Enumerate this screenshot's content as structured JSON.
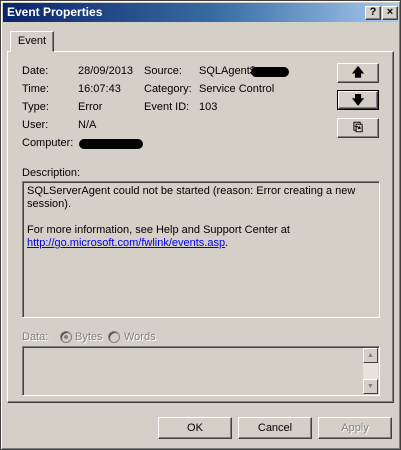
{
  "window": {
    "title": "Event Properties",
    "help_glyph": "?",
    "close_glyph": "×"
  },
  "tabs": [
    {
      "label": "Event"
    }
  ],
  "event": {
    "date_label": "Date:",
    "date_value": "28/09/2013",
    "source_label": "Source:",
    "source_value": "SQLAgent$",
    "time_label": "Time:",
    "time_value": "16:07:43",
    "category_label": "Category:",
    "category_value": "Service Control",
    "type_label": "Type:",
    "type_value": "Error",
    "eventid_label": "Event ID:",
    "eventid_value": "103",
    "user_label": "User:",
    "user_value": "N/A",
    "computer_label": "Computer:"
  },
  "nav": {
    "up_glyph": "🡅",
    "down_glyph": "🡇",
    "copy_glyph": "⎘"
  },
  "description": {
    "label": "Description:",
    "line1": "SQLServerAgent could not be started (reason: Error creating a new session).",
    "line2": "For more information, see Help and Support Center at",
    "link": "http://go.microsoft.com/fwlink/events.asp",
    "link_suffix": "."
  },
  "data_section": {
    "label": "Data:",
    "bytes_label": "Bytes",
    "words_label": "Words"
  },
  "buttons": {
    "ok": "OK",
    "cancel": "Cancel",
    "apply": "Apply"
  }
}
